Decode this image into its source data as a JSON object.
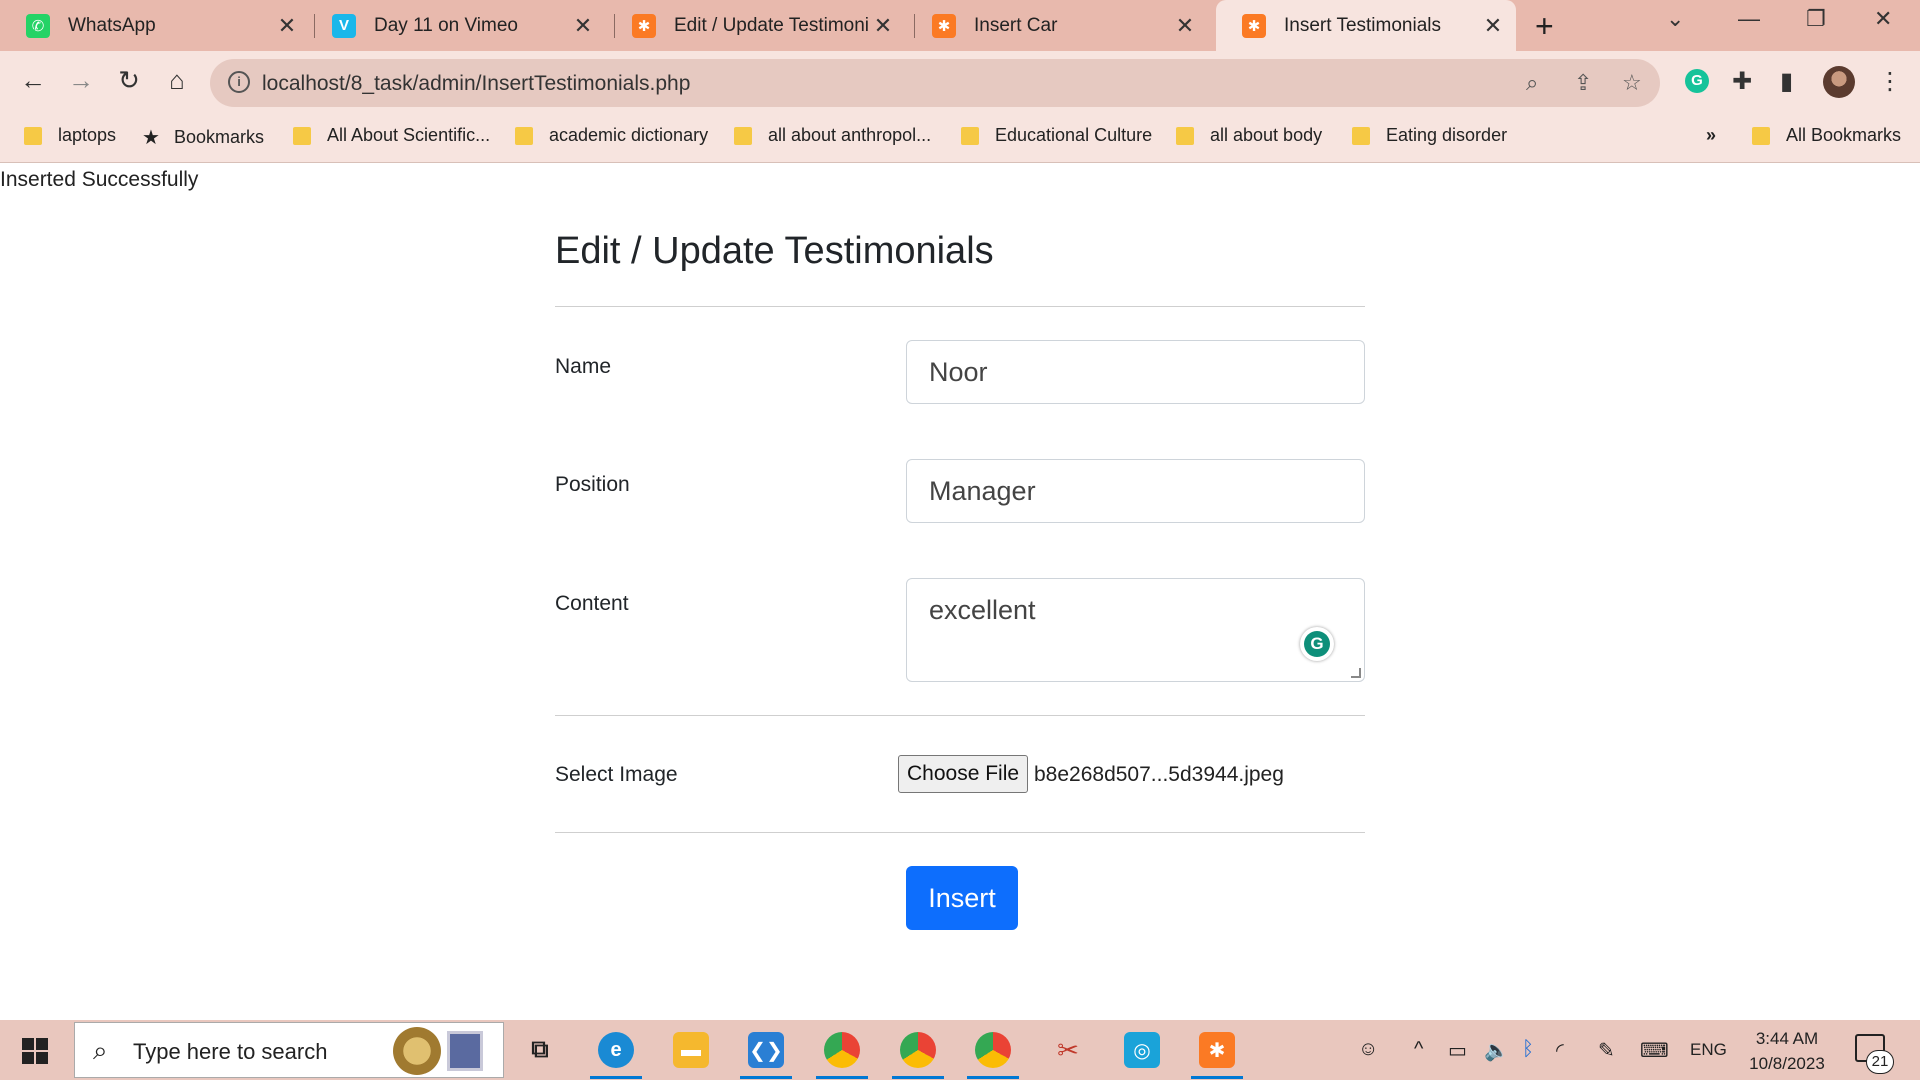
{
  "browser": {
    "tabs": [
      {
        "title": "WhatsApp",
        "icon": "whatsapp-icon"
      },
      {
        "title": "Day 11 on Vimeo",
        "icon": "vimeo-icon"
      },
      {
        "title": "Edit / Update Testimonials",
        "icon": "xampp-icon"
      },
      {
        "title": "Insert Car",
        "icon": "xampp-icon"
      },
      {
        "title": "Insert Testimonials",
        "icon": "xampp-icon",
        "active": true
      }
    ],
    "url": "localhost/8_task/admin/InsertTestimonials.php",
    "bookmarks": [
      {
        "label": "laptops",
        "type": "folder"
      },
      {
        "label": "Bookmarks",
        "type": "star"
      },
      {
        "label": "All About Scientific...",
        "type": "folder"
      },
      {
        "label": "academic dictionary",
        "type": "folder"
      },
      {
        "label": "all about anthropol...",
        "type": "folder"
      },
      {
        "label": "Educational Culture",
        "type": "folder"
      },
      {
        "label": "all about body",
        "type": "folder"
      },
      {
        "label": "Eating disorder",
        "type": "folder"
      }
    ],
    "overflow": "»",
    "all_bookmarks": "All Bookmarks"
  },
  "page": {
    "message": "Inserted Successfully",
    "heading": "Edit / Update Testimonials",
    "fields": {
      "name_label": "Name",
      "name_value": "Noor",
      "position_label": "Position",
      "position_value": "Manager",
      "content_label": "Content",
      "content_value": "excellent",
      "image_label": "Select Image",
      "file_button": "Choose File",
      "file_name": "b8e268d507...5d3944.jpeg"
    },
    "submit_label": "Insert"
  },
  "taskbar": {
    "search_placeholder": "Type here to search",
    "language": "ENG",
    "time": "3:44 AM",
    "date": "10/8/2023",
    "notification_count": "21"
  },
  "colors": {
    "chrome_tabbar": "#e8b9ad",
    "chrome_toolbar": "#f7e4df",
    "primary_button": "#0d6efd",
    "taskbar": "#e9c7be"
  }
}
